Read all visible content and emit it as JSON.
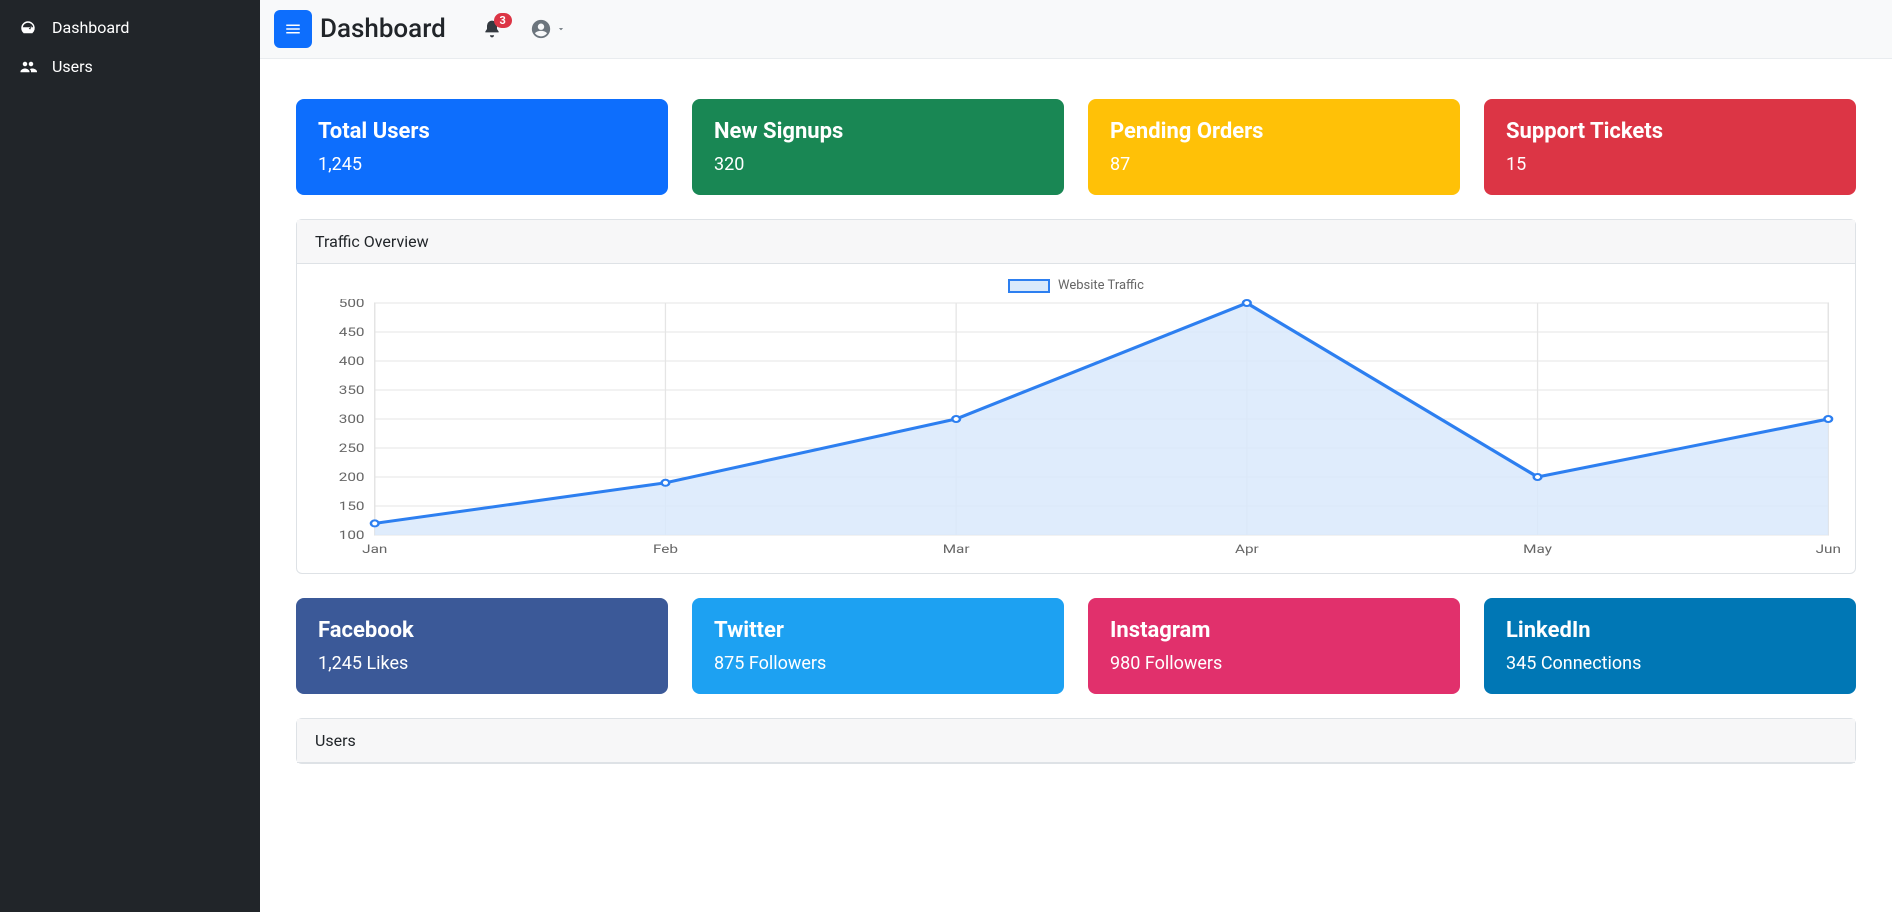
{
  "sidebar": {
    "items": [
      {
        "label": "Dashboard",
        "icon": "gauge-icon"
      },
      {
        "label": "Users",
        "icon": "users-icon"
      }
    ]
  },
  "header": {
    "title": "Dashboard",
    "notification_count": "3"
  },
  "stats": [
    {
      "title": "Total Users",
      "value": "1,245",
      "color": "bg-primary"
    },
    {
      "title": "New Signups",
      "value": "320",
      "color": "bg-success"
    },
    {
      "title": "Pending Orders",
      "value": "87",
      "color": "bg-warning"
    },
    {
      "title": "Support Tickets",
      "value": "15",
      "color": "bg-danger"
    }
  ],
  "traffic_panel": {
    "title": "Traffic Overview"
  },
  "chart_data": {
    "type": "line",
    "legend": "Website Traffic",
    "categories": [
      "Jan",
      "Feb",
      "Mar",
      "Apr",
      "May",
      "Jun"
    ],
    "values": [
      120,
      190,
      300,
      500,
      200,
      300
    ],
    "y_ticks": [
      100,
      150,
      200,
      250,
      300,
      350,
      400,
      450,
      500
    ],
    "ylim": [
      100,
      500
    ]
  },
  "social": [
    {
      "title": "Facebook",
      "value": "1,245 Likes",
      "color": "bg-facebook"
    },
    {
      "title": "Twitter",
      "value": "875 Followers",
      "color": "bg-twitter"
    },
    {
      "title": "Instagram",
      "value": "980 Followers",
      "color": "bg-instagram"
    },
    {
      "title": "LinkedIn",
      "value": "345 Connections",
      "color": "bg-linkedin"
    }
  ],
  "users_panel": {
    "title": "Users"
  }
}
